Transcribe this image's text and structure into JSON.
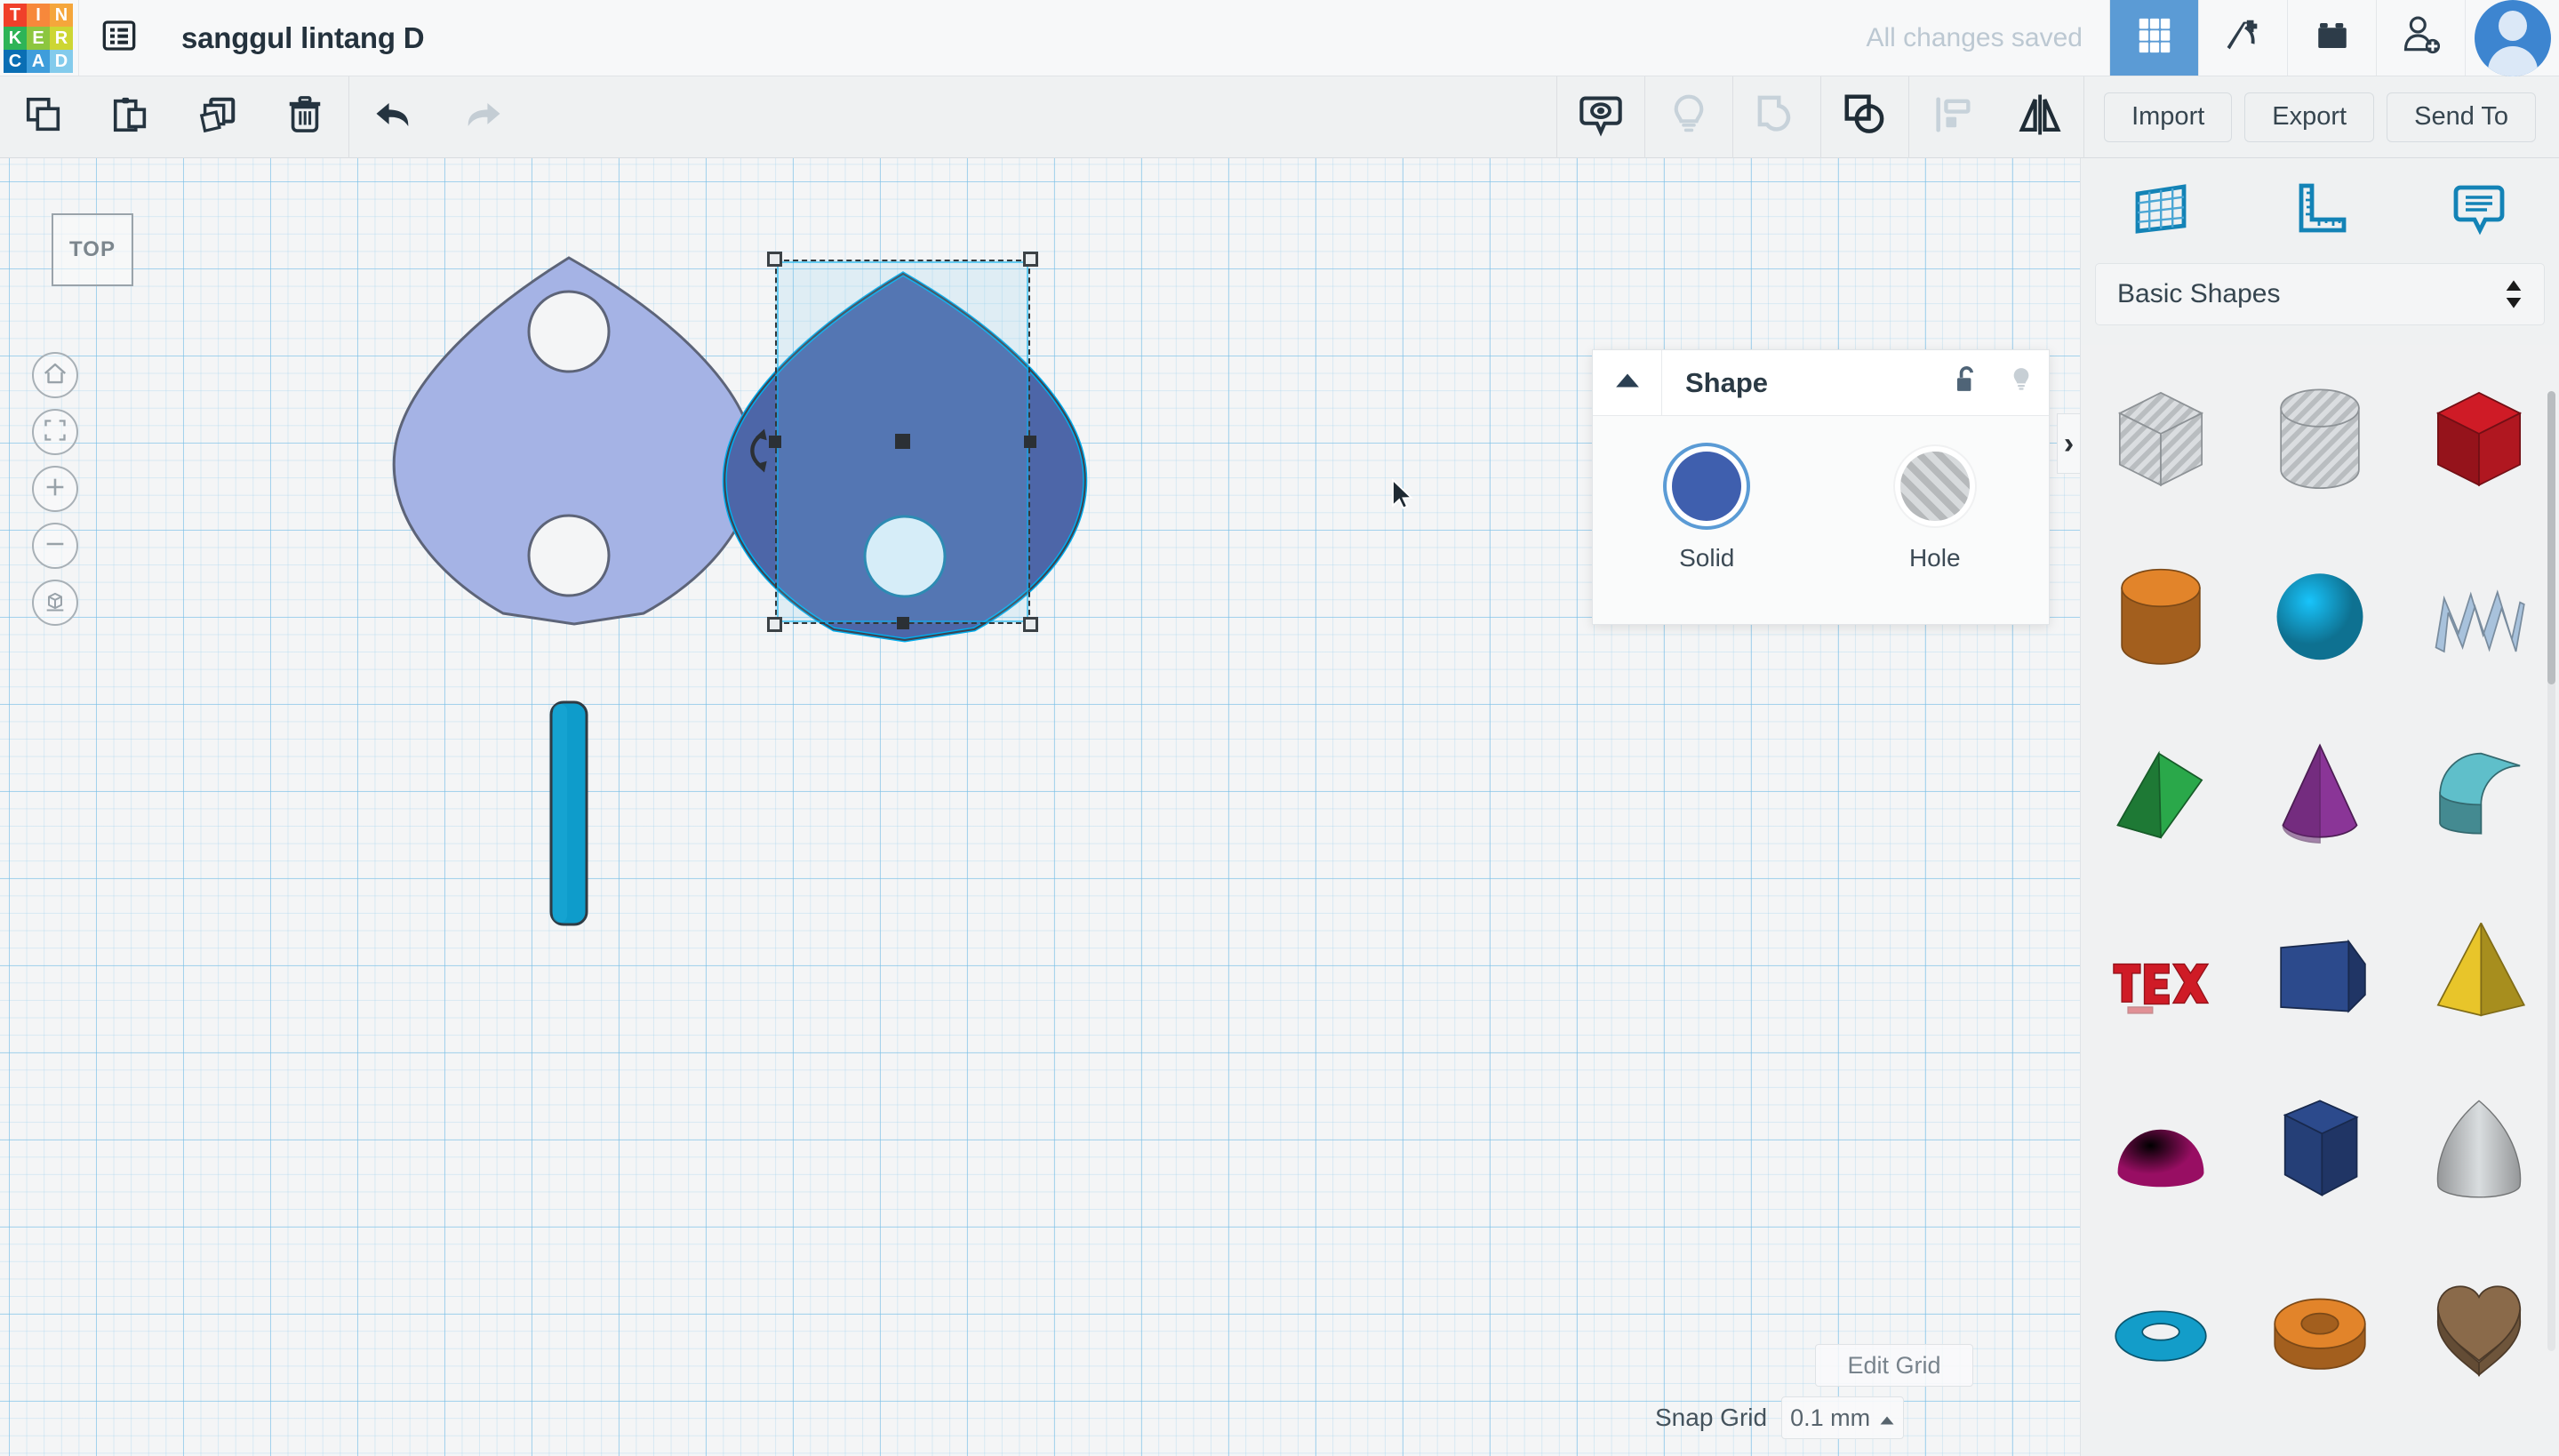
{
  "header": {
    "logo": {
      "name": "tinkercad-logo",
      "letters": [
        "T",
        "I",
        "N",
        "K",
        "E",
        "R",
        "C",
        "A",
        "D"
      ],
      "colors": [
        "#f0402a",
        "#f7883b",
        "#f5a63b",
        "#2eb457",
        "#8cc63f",
        "#cdd633",
        "#0a6eb4",
        "#3f9ddb",
        "#83cbec"
      ]
    },
    "menu_icon": "hamburger-list-icon",
    "title": "sanggul lintang D",
    "save_status": "All changes saved",
    "buttons": [
      {
        "name": "grid-view-button",
        "icon": "grid-icon",
        "active": true
      },
      {
        "name": "codeblocks-button",
        "icon": "pickaxe-icon",
        "active": false
      },
      {
        "name": "blocks-button",
        "icon": "lego-brick-icon",
        "active": false
      },
      {
        "name": "invite-person-button",
        "icon": "person-add-icon",
        "active": false
      }
    ],
    "avatar": "user-avatar"
  },
  "toolbar": {
    "left_tools": [
      {
        "name": "copy-button",
        "icon": "copy-icon"
      },
      {
        "name": "paste-button",
        "icon": "clipboard-paste-icon"
      },
      {
        "name": "duplicate-button",
        "icon": "duplicate-layers-icon"
      },
      {
        "name": "delete-button",
        "icon": "trash-icon"
      },
      {
        "name": "undo-button",
        "icon": "undo-arrow-icon"
      },
      {
        "name": "redo-button",
        "icon": "redo-arrow-icon"
      }
    ],
    "right_tools": [
      {
        "name": "workplane-button",
        "icon": "workplane-eye-icon"
      },
      {
        "name": "hint-button",
        "icon": "lightbulb-icon"
      },
      {
        "name": "group-button",
        "icon": "group-shapes-icon"
      },
      {
        "name": "ungroup-button",
        "icon": "ungroup-shapes-icon"
      },
      {
        "name": "align-button",
        "icon": "align-icon"
      },
      {
        "name": "mirror-button",
        "icon": "mirror-flip-icon"
      }
    ],
    "import_label": "Import",
    "export_label": "Export",
    "sendto_label": "Send To"
  },
  "canvas": {
    "view_cube_label": "TOP",
    "nav_buttons": [
      {
        "name": "home-view-button",
        "icon": "home-icon"
      },
      {
        "name": "fit-view-button",
        "icon": "fit-frame-icon"
      },
      {
        "name": "zoom-in-button",
        "icon": "plus-icon"
      },
      {
        "name": "zoom-out-button",
        "icon": "minus-icon"
      },
      {
        "name": "ortho-perspective-button",
        "icon": "box-view-icon"
      }
    ],
    "panel_toggle_icon": "chevron-right-icon",
    "rotate_handle_icon": "rotate-arc-icon",
    "edit_grid_label": "Edit Grid",
    "snap_grid_label": "Snap Grid",
    "snap_grid_value": "0.1 mm",
    "snap_grid_caret": "caret-up-icon",
    "shapes": [
      {
        "name": "leaf-shape-unselected",
        "fill": "#a5b3e5",
        "stroke": "#5d6478",
        "selected": false
      },
      {
        "name": "leaf-shape-selected",
        "fill": "#4d66a8",
        "stroke": "#00aeef",
        "selected": true
      },
      {
        "name": "cylinder-shape-teal",
        "fill": "#0e9ccb",
        "stroke": "#2f3b44",
        "selected": false
      }
    ]
  },
  "shape_popup": {
    "collapse_icon": "caret-up-icon",
    "title": "Shape",
    "lock_icon": "unlocked-padlock-icon",
    "bulb_icon": "lightbulb-icon",
    "options": [
      {
        "name": "solid-option",
        "label": "Solid",
        "selected": true,
        "color": "#3f5fae"
      },
      {
        "name": "hole-option",
        "label": "Hole",
        "selected": false,
        "color": "#c0c4c7"
      }
    ]
  },
  "right_panel": {
    "tabs": [
      {
        "name": "workplane-tab",
        "icon": "workplane-grid-icon"
      },
      {
        "name": "ruler-tab",
        "icon": "ruler-icon"
      },
      {
        "name": "note-tab",
        "icon": "note-callout-icon"
      }
    ],
    "library_select": "Basic Shapes",
    "library_caret": "updown-spinner-icon",
    "shapes": [
      {
        "name": "shape-box-hole",
        "label": "Box Hole",
        "type": "cube-striped",
        "color": "#c9cdd0"
      },
      {
        "name": "shape-cylinder-hole",
        "label": "Cylinder Hole",
        "type": "cylinder-striped",
        "color": "#c9cdd0"
      },
      {
        "name": "shape-box",
        "label": "Box",
        "type": "cube",
        "color": "#cf1b26"
      },
      {
        "name": "shape-cylinder",
        "label": "Cylinder",
        "type": "cylinder",
        "color": "#e2842a"
      },
      {
        "name": "shape-sphere",
        "label": "Sphere",
        "type": "sphere",
        "color": "#139dc9"
      },
      {
        "name": "shape-scribble",
        "label": "Scribble",
        "type": "scribble",
        "color": "#a8c2dc"
      },
      {
        "name": "shape-wedge",
        "label": "Wedge",
        "type": "wedge",
        "color": "#2aa84a"
      },
      {
        "name": "shape-cone",
        "label": "Cone",
        "type": "cone",
        "color": "#8a3597"
      },
      {
        "name": "shape-roof",
        "label": "Roof",
        "type": "roof",
        "color": "#5fbfca"
      },
      {
        "name": "shape-text",
        "label": "Text",
        "type": "text3d",
        "color": "#cf1b26"
      },
      {
        "name": "shape-tube",
        "label": "Tube",
        "type": "slab",
        "color": "#2c4a8c"
      },
      {
        "name": "shape-pyramid",
        "label": "Pyramid",
        "type": "pyramid",
        "color": "#e8c52a"
      },
      {
        "name": "shape-halfsphere",
        "label": "Half Sphere",
        "type": "halfsphere",
        "color": "#d3148a"
      },
      {
        "name": "shape-polygon",
        "label": "Polygon",
        "type": "hexprism",
        "color": "#2c4a8c"
      },
      {
        "name": "shape-paraboloid",
        "label": "Paraboloid",
        "type": "paraboloid",
        "color": "#cfd2d4"
      },
      {
        "name": "shape-torus",
        "label": "Torus",
        "type": "torus",
        "color": "#139dc9"
      },
      {
        "name": "shape-round-roof",
        "label": "Round Roof",
        "type": "ring",
        "color": "#e2842a"
      },
      {
        "name": "shape-heart",
        "label": "Heart",
        "type": "heart",
        "color": "#8a6a4a"
      }
    ]
  }
}
